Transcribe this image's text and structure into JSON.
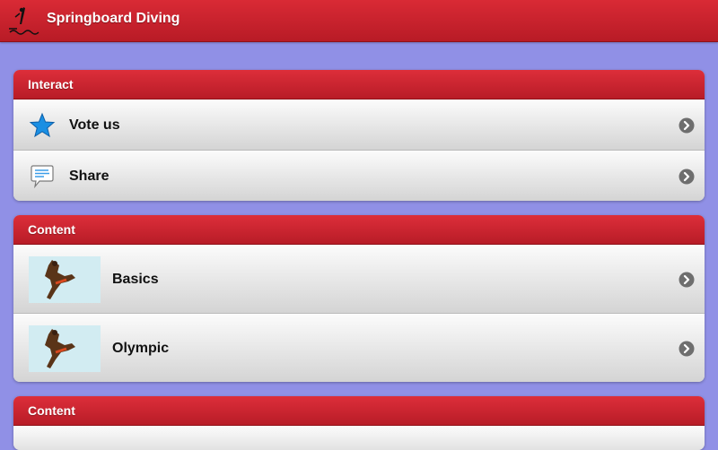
{
  "app": {
    "title": "Springboard Diving",
    "logo_icon": "diver-logo-icon"
  },
  "colors": {
    "background": "#9090e6",
    "accent": "#d0232e",
    "header_text": "#ffffff"
  },
  "groups": [
    {
      "header": "Interact",
      "items": [
        {
          "label": "Vote us",
          "icon": "star-icon"
        },
        {
          "label": "Share",
          "icon": "speech-bubble-icon"
        }
      ]
    },
    {
      "header": "Content",
      "items": [
        {
          "label": "Basics",
          "icon": "diver-thumbnail"
        },
        {
          "label": "Olympic",
          "icon": "diver-thumbnail"
        }
      ]
    },
    {
      "header": "Content",
      "items": []
    }
  ]
}
